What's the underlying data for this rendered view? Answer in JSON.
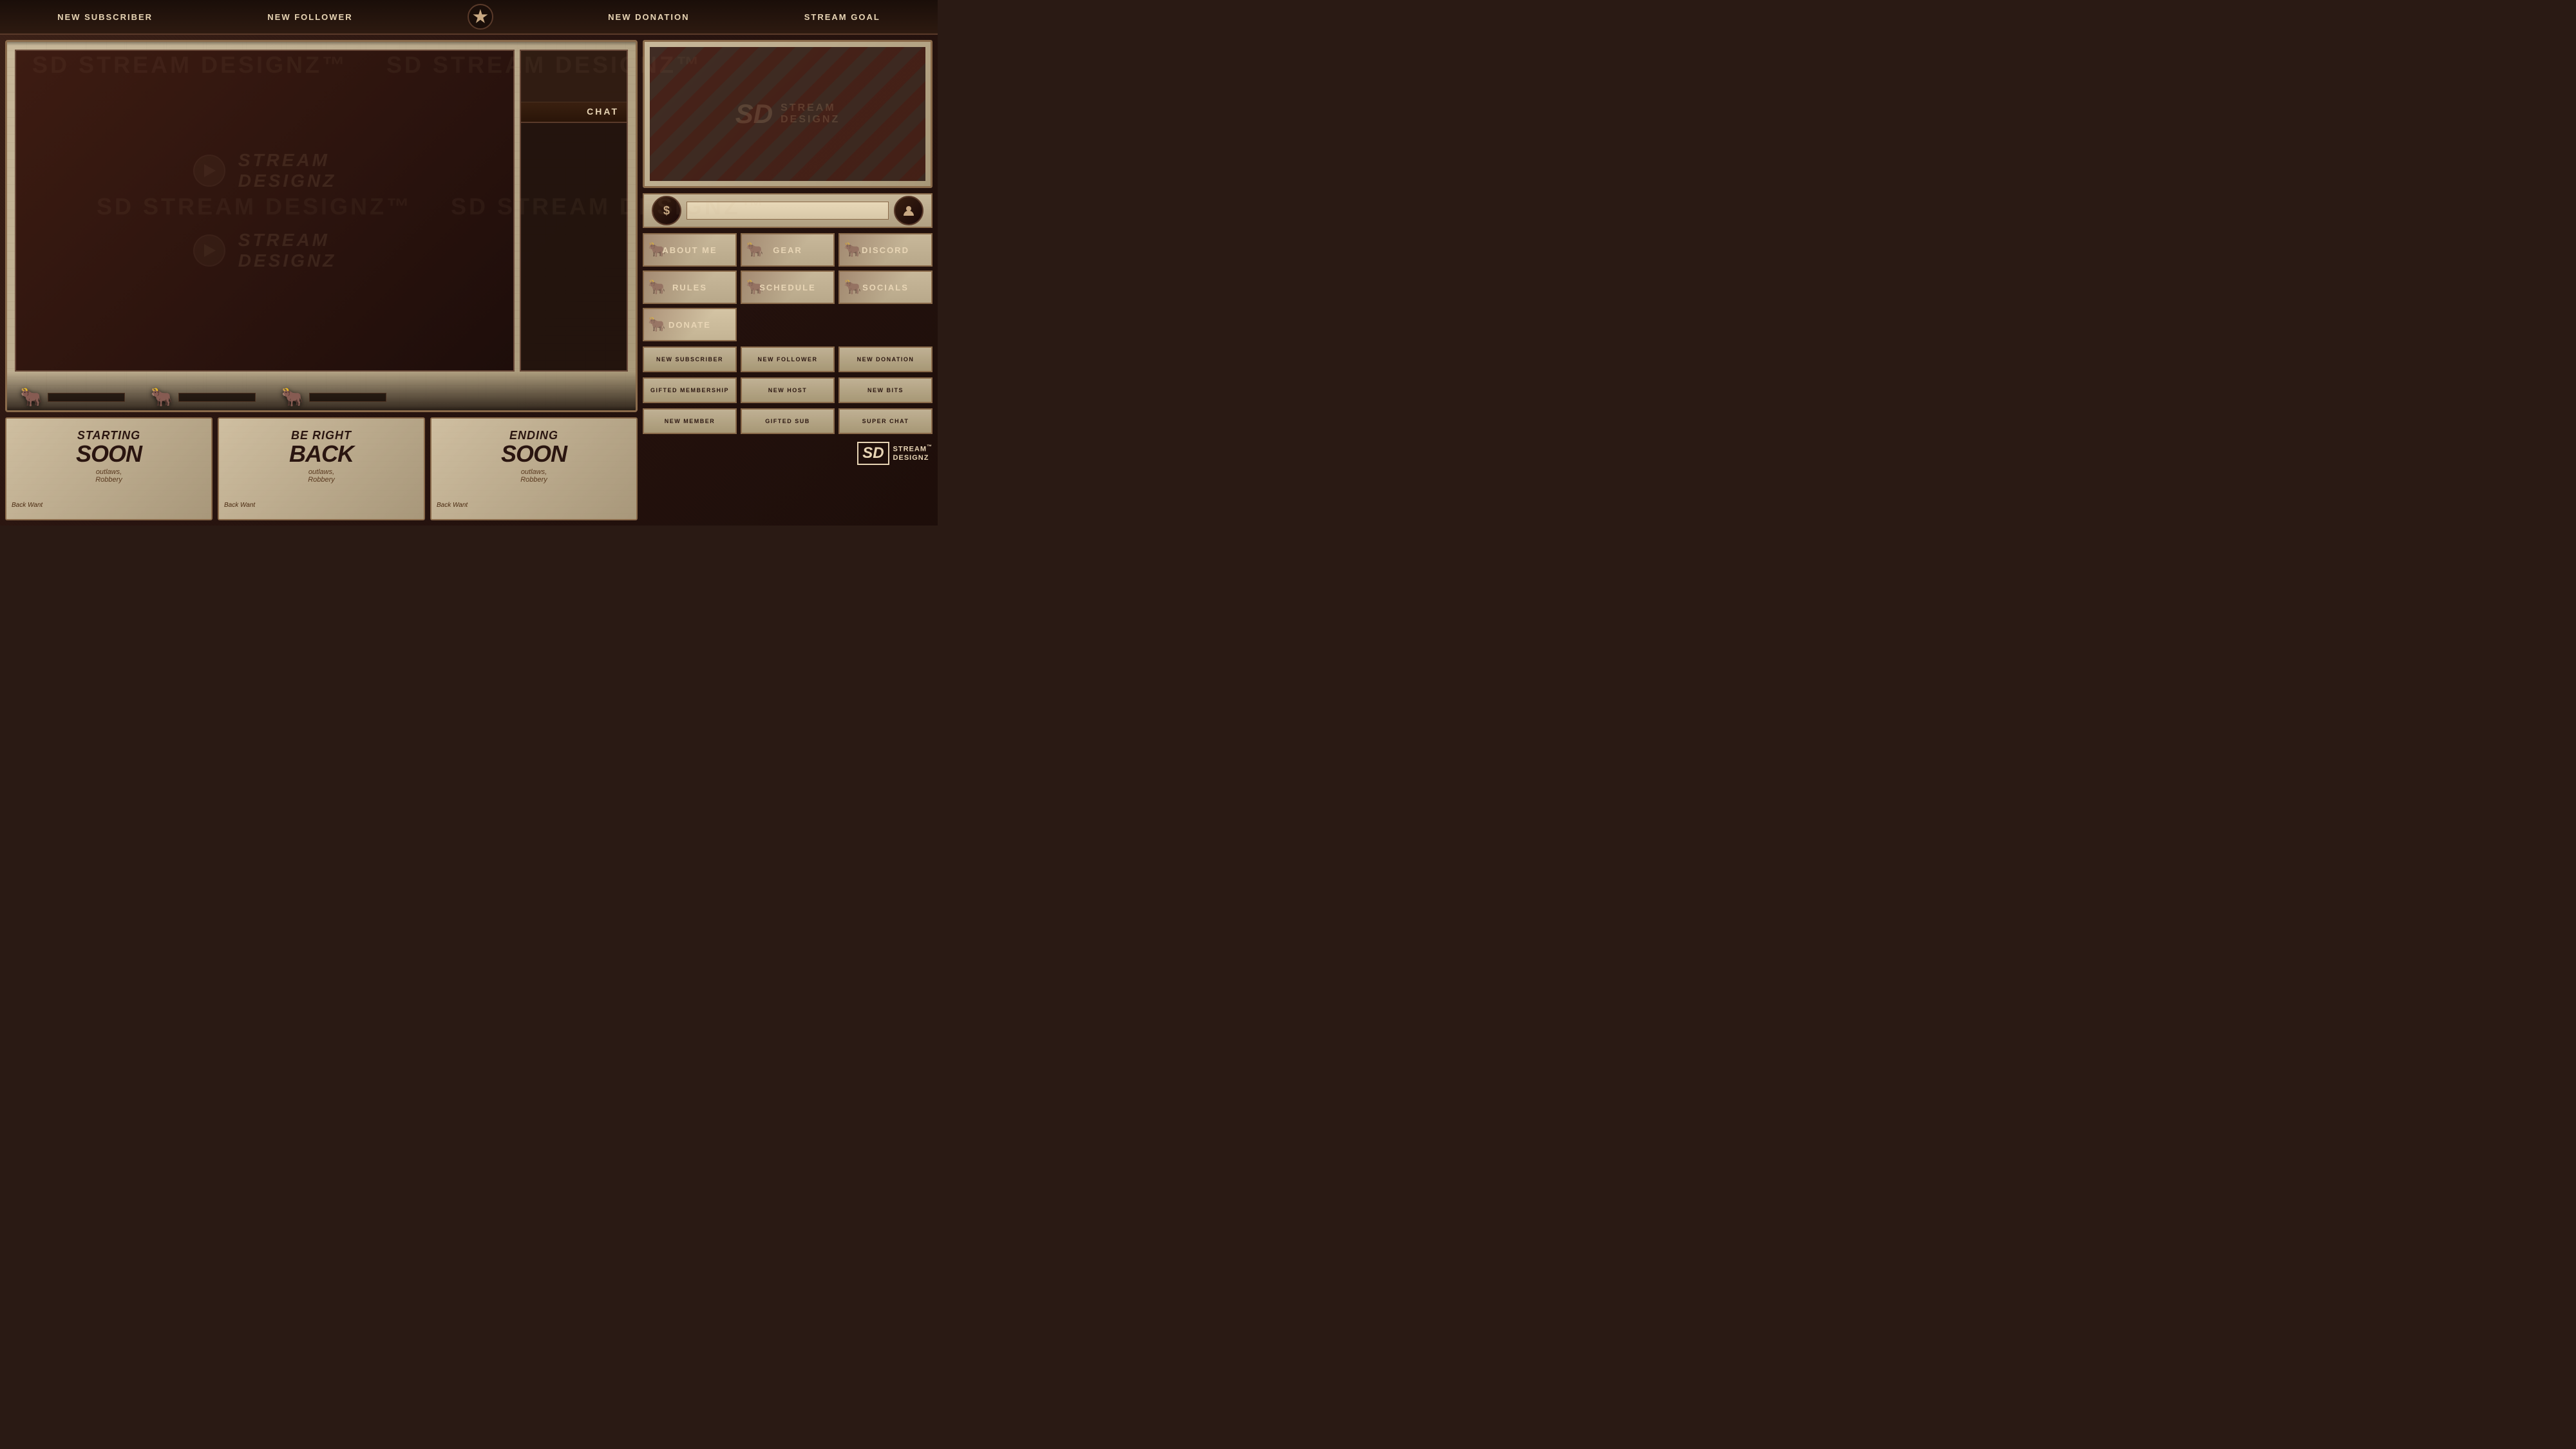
{
  "top_bar": {
    "new_subscriber": "NEW SUBSCRIBER",
    "new_follower": "NEW FOLLOWER",
    "new_donation": "NEW DONATION",
    "stream_goal": "STREAM GOAL"
  },
  "chat": {
    "label": "CHAT"
  },
  "buttons": {
    "about_me": "ABOUT ME",
    "gear": "GEAR",
    "discord": "DISCORD",
    "rules": "RULES",
    "schedule": "SCHEDULE",
    "socials": "SOCIALS",
    "donate": "DONATE"
  },
  "alerts": {
    "new_subscriber": "NEW SUBSCRIBER",
    "new_follower": "NEW FOLLOWER",
    "new_donation": "NEW DONATION",
    "gifted_membership": "GIFTED MEMBERSHIP",
    "new_host": "NEW HOST",
    "new_bits": "NEW BITS",
    "new_member": "NEW MEMBER",
    "gifted_sub": "GIFTED SUB",
    "super_chat": "SUPER CHAT"
  },
  "preview_screens": {
    "starting_soon": {
      "line1": "STARTING",
      "line2": "SOON",
      "subtitle": "outlaws,",
      "sub2": "Robbery"
    },
    "be_right_back": {
      "line1": "BE RIGHT",
      "line2": "BACK",
      "subtitle": "outlaws,",
      "sub2": "Robbery"
    },
    "ending_soon": {
      "line1": "ENDING",
      "line2": "SOON",
      "subtitle": "outlaws,",
      "sub2": "Robbery"
    }
  },
  "brand": {
    "sd": "SD",
    "name": "STREAM\nDESIGNZ",
    "tm": "™"
  },
  "watermark": {
    "text": "SD STREAM DESIGNZ"
  }
}
